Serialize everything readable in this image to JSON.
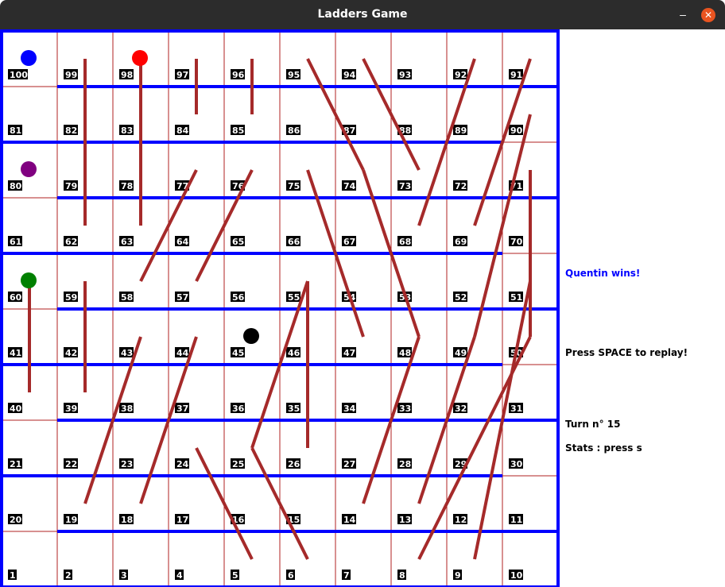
{
  "window": {
    "title": "Ladders Game",
    "minimize_glyph": "–",
    "close_glyph": "✕"
  },
  "board": {
    "squares": [
      "1",
      "2",
      "3",
      "4",
      "5",
      "6",
      "7",
      "8",
      "9",
      "10",
      "11",
      "12",
      "13",
      "14",
      "15",
      "16",
      "17",
      "18",
      "19",
      "20",
      "21",
      "22",
      "23",
      "24",
      "25",
      "26",
      "27",
      "28",
      "29",
      "30",
      "31",
      "32",
      "33",
      "34",
      "35",
      "36",
      "37",
      "38",
      "39",
      "40",
      "41",
      "42",
      "43",
      "44",
      "45",
      "46",
      "47",
      "48",
      "49",
      "50",
      "51",
      "52",
      "53",
      "54",
      "55",
      "56",
      "57",
      "58",
      "59",
      "60",
      "61",
      "62",
      "63",
      "64",
      "65",
      "66",
      "67",
      "68",
      "69",
      "70",
      "71",
      "72",
      "73",
      "74",
      "75",
      "76",
      "77",
      "78",
      "79",
      "80",
      "81",
      "82",
      "83",
      "84",
      "85",
      "86",
      "87",
      "88",
      "89",
      "90",
      "91",
      "92",
      "93",
      "94",
      "95",
      "96",
      "97",
      "98",
      "99",
      "100"
    ],
    "colors": {
      "wall": "#0000ff",
      "grid": "#b22222",
      "connector": "#a52a2a",
      "label_bg": "#000000",
      "label_text": "#ffffff"
    },
    "walls": [
      {
        "row": 1,
        "cols": [
          2,
          10
        ]
      },
      {
        "row": 2,
        "cols": [
          1,
          9
        ]
      },
      {
        "row": 3,
        "cols": [
          2,
          10
        ]
      },
      {
        "row": 4,
        "cols": [
          1,
          9
        ]
      },
      {
        "row": 5,
        "cols": [
          2,
          10
        ]
      },
      {
        "row": 6,
        "cols": [
          1,
          9
        ]
      },
      {
        "row": 7,
        "cols": [
          2,
          10
        ]
      },
      {
        "row": 8,
        "cols": [
          1,
          9
        ]
      },
      {
        "row": 9,
        "cols": [
          2,
          10
        ]
      }
    ],
    "connectors": [
      {
        "from": 62,
        "to": 99
      },
      {
        "from": 63,
        "to": 98
      },
      {
        "from": 84,
        "to": 97
      },
      {
        "from": 85,
        "to": 96
      },
      {
        "from": 95,
        "to": 74
      },
      {
        "from": 94,
        "to": 73
      },
      {
        "from": 68,
        "to": 92
      },
      {
        "from": 69,
        "to": 91
      },
      {
        "from": 58,
        "to": 77
      },
      {
        "from": 57,
        "to": 76
      },
      {
        "from": 75,
        "to": 47
      },
      {
        "from": 74,
        "to": 48
      },
      {
        "from": 49,
        "to": 90
      },
      {
        "from": 50,
        "to": 71
      },
      {
        "from": 60,
        "to": 40
      },
      {
        "from": 59,
        "to": 39
      },
      {
        "from": 19,
        "to": 43
      },
      {
        "from": 18,
        "to": 44
      },
      {
        "from": 25,
        "to": 55
      },
      {
        "from": 26,
        "to": 55
      },
      {
        "from": 24,
        "to": 5
      },
      {
        "from": 25,
        "to": 6
      },
      {
        "from": 14,
        "to": 48
      },
      {
        "from": 13,
        "to": 49
      },
      {
        "from": 8,
        "to": 50
      },
      {
        "from": 9,
        "to": 51
      }
    ],
    "tokens": [
      {
        "name": "blue-token",
        "square": 100,
        "color": "#0000ff"
      },
      {
        "name": "red-token",
        "square": 98,
        "color": "#ff0000"
      },
      {
        "name": "purple-token",
        "square": 80,
        "color": "#800080"
      },
      {
        "name": "green-token",
        "square": 60,
        "color": "#008000"
      },
      {
        "name": "black-token",
        "square": 45,
        "color": "#000000"
      }
    ]
  },
  "panel": {
    "winner": "Quentin wins!",
    "replay": "Press SPACE to replay!",
    "turn": "Turn n° 15",
    "stats": "Stats : press s"
  }
}
